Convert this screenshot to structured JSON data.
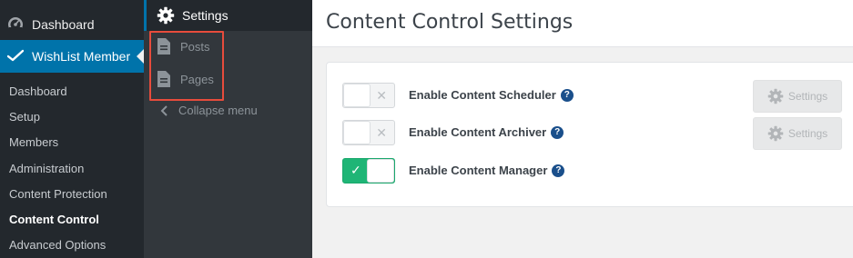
{
  "sidebar": {
    "dashboard_label": "Dashboard",
    "wishlist_label": "WishList Member",
    "items": [
      {
        "label": "Dashboard"
      },
      {
        "label": "Setup"
      },
      {
        "label": "Members"
      },
      {
        "label": "Administration"
      },
      {
        "label": "Content Protection"
      },
      {
        "label": "Content Control",
        "current": true
      },
      {
        "label": "Advanced Options"
      }
    ]
  },
  "submenu": {
    "settings_label": "Settings",
    "posts_label": "Posts",
    "pages_label": "Pages",
    "collapse_label": "Collapse menu"
  },
  "main": {
    "title": "Content Control Settings",
    "settings": [
      {
        "label": "Enable Content Scheduler",
        "enabled": false,
        "button_label": "Settings",
        "has_button": true
      },
      {
        "label": "Enable Content Archiver",
        "enabled": false,
        "button_label": "Settings",
        "has_button": true
      },
      {
        "label": "Enable Content Manager",
        "enabled": true,
        "has_button": false
      }
    ]
  },
  "icons": {
    "dashboard": "dashboard-icon",
    "wishlist": "wishlist-icon",
    "settings": "gear-icon",
    "posts": "document-icon",
    "pages": "document-icon",
    "collapse": "chevron-left-icon",
    "help": "help-icon",
    "toggle_off": "x-icon",
    "toggle_on": "check-icon"
  },
  "colors": {
    "sidebar_bg": "#23282d",
    "active_blue": "#0073aa",
    "toggle_on": "#1fb576",
    "highlight_border": "#e74c3c",
    "help_icon": "#1a4f8b"
  }
}
